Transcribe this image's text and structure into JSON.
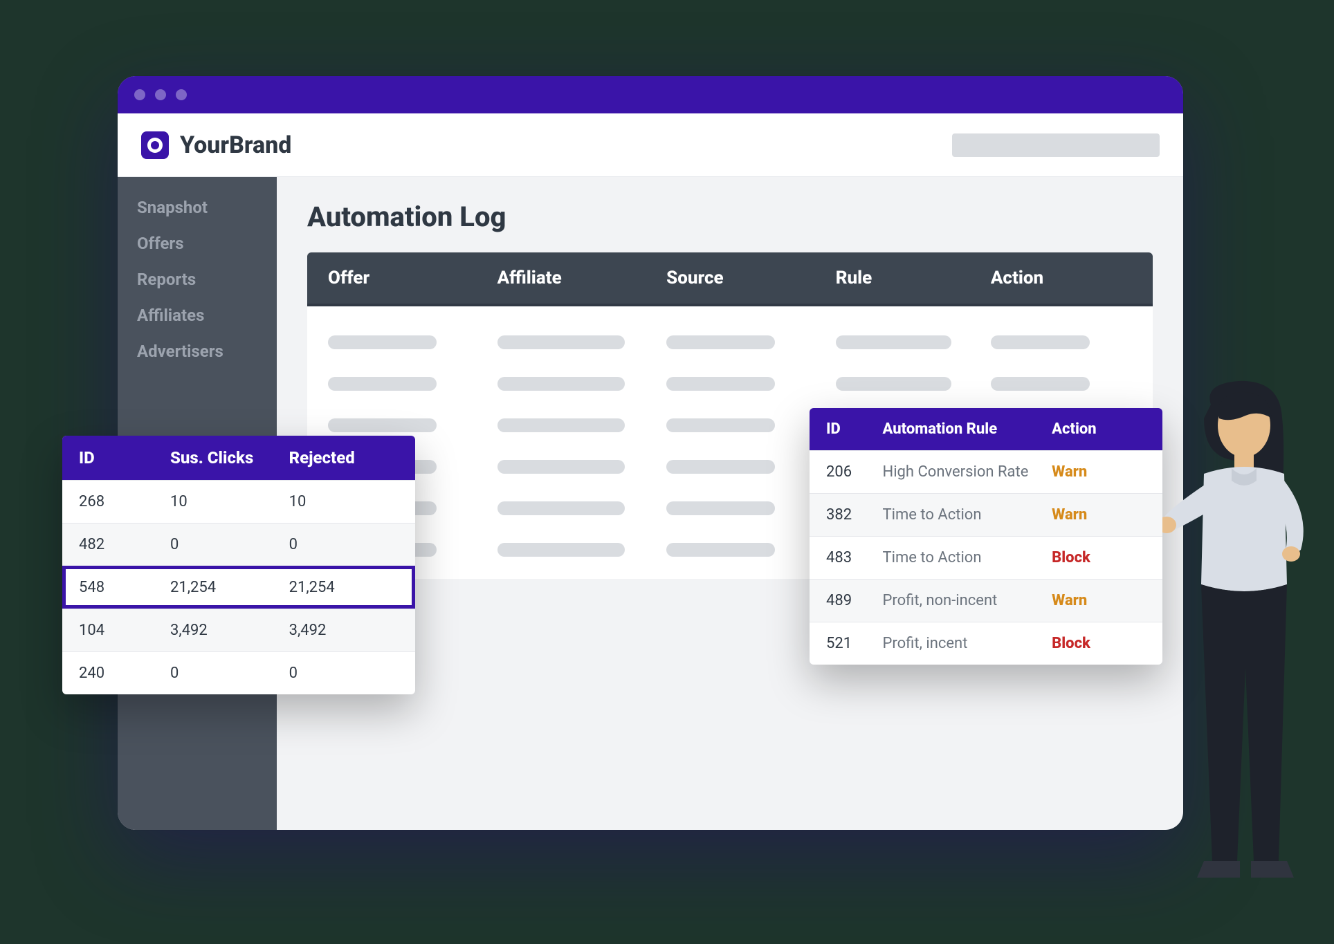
{
  "brand": {
    "name": "YourBrand"
  },
  "sidebar": {
    "items": [
      {
        "label": "Snapshot"
      },
      {
        "label": "Offers"
      },
      {
        "label": "Reports"
      },
      {
        "label": "Affiliates"
      },
      {
        "label": "Advertisers"
      }
    ]
  },
  "page": {
    "title": "Automation Log"
  },
  "log": {
    "headers": {
      "offer": "Offer",
      "affiliate": "Affiliate",
      "source": "Source",
      "rule": "Rule",
      "action": "Action"
    },
    "placeholder_rows": 6
  },
  "clicks_panel": {
    "headers": {
      "id": "ID",
      "sus": "Sus. Clicks",
      "rejected": "Rejected"
    },
    "rows": [
      {
        "id": "268",
        "sus": "10",
        "rejected": "10",
        "highlight": false
      },
      {
        "id": "482",
        "sus": "0",
        "rejected": "0",
        "highlight": false
      },
      {
        "id": "548",
        "sus": "21,254",
        "rejected": "21,254",
        "highlight": true
      },
      {
        "id": "104",
        "sus": "3,492",
        "rejected": "3,492",
        "highlight": false
      },
      {
        "id": "240",
        "sus": "0",
        "rejected": "0",
        "highlight": false
      }
    ]
  },
  "rules_panel": {
    "headers": {
      "id": "ID",
      "rule": "Automation Rule",
      "action": "Action"
    },
    "rows": [
      {
        "id": "206",
        "rule": "High Conversion Rate",
        "action": "Warn",
        "level": "warn"
      },
      {
        "id": "382",
        "rule": "Time to Action",
        "action": "Warn",
        "level": "warn"
      },
      {
        "id": "483",
        "rule": "Time to Action",
        "action": "Block",
        "level": "block"
      },
      {
        "id": "489",
        "rule": "Profit, non-incent",
        "action": "Warn",
        "level": "warn"
      },
      {
        "id": "521",
        "rule": "Profit, incent",
        "action": "Block",
        "level": "block"
      }
    ]
  }
}
